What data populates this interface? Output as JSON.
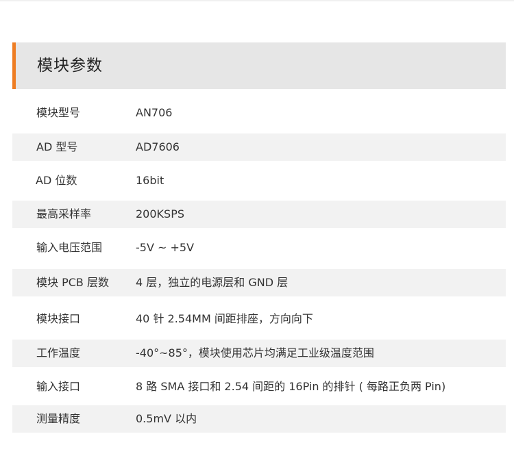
{
  "section": {
    "title": "模块参数",
    "accent_color": "#ee7d23",
    "header_bg": "#e6e6e6",
    "stripe_bg": "#f2f2f2"
  },
  "rows": [
    {
      "label": "模块型号",
      "value": "AN706"
    },
    {
      "label": "AD 型号",
      "value": "AD7606"
    },
    {
      "label": "AD 位数",
      "value": "16bit"
    },
    {
      "label": "最高采样率",
      "value": "200KSPS"
    },
    {
      "label": "输入电压范围",
      "value": "-5V ~ +5V"
    },
    {
      "label": "模块 PCB 层数",
      "value": "4 层，独立的电源层和 GND 层"
    },
    {
      "label": "模块接口",
      "value": "40 针 2.54MM 间距排座，方向向下"
    },
    {
      "label": "工作温度",
      "value": "-40°~85°，模块使用芯片均满足工业级温度范围"
    },
    {
      "label": "输入接口",
      "value": "8 路 SMA 接口和 2.54 间距的 16Pin 的排针 ( 每路正负两 Pin)"
    },
    {
      "label": "测量精度",
      "value": "0.5mV 以内"
    }
  ]
}
